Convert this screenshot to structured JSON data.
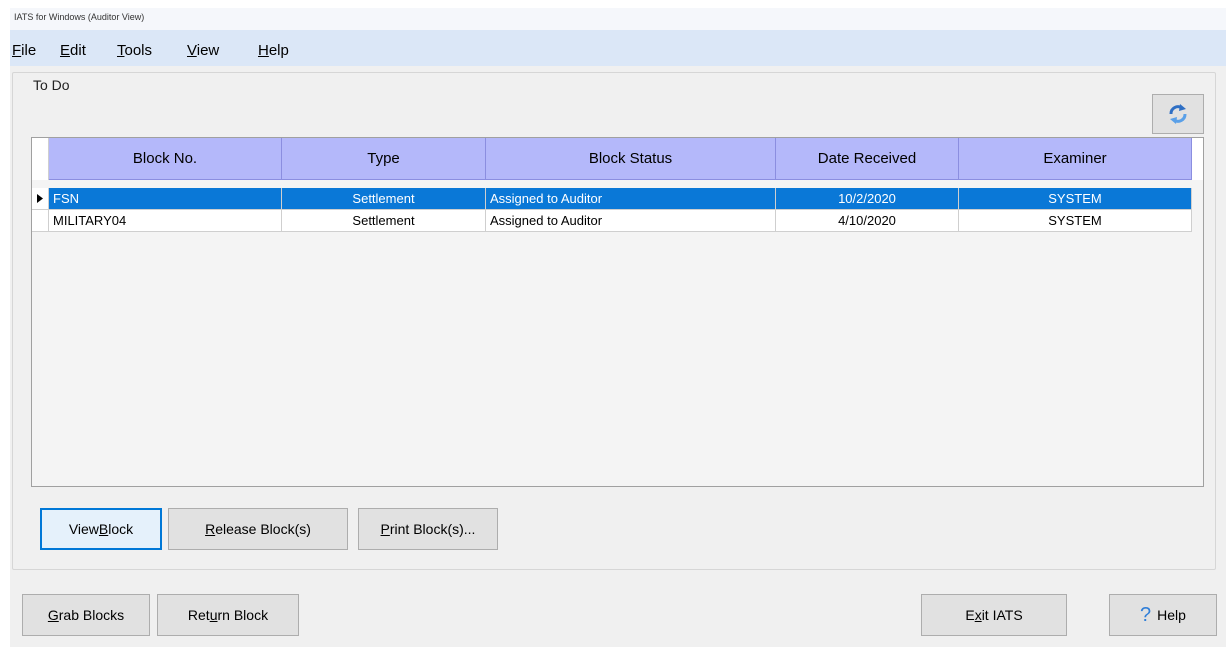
{
  "window": {
    "title": "IATS for Windows (Auditor View)"
  },
  "menu": [
    {
      "label": "File",
      "mnemonic": "F",
      "rest": "ile"
    },
    {
      "label": "Edit",
      "mnemonic": "E",
      "rest": "dit"
    },
    {
      "label": "Tools",
      "mnemonic": "T",
      "rest": "ools"
    },
    {
      "label": "View",
      "mnemonic": "V",
      "rest": "iew"
    },
    {
      "label": "Help",
      "mnemonic": "H",
      "rest": "elp"
    }
  ],
  "todo": {
    "group_label": "To Do",
    "refresh_icon": "refresh-icon",
    "columns": [
      "Block No.",
      "Type",
      "Block Status",
      "Date Received",
      "Examiner"
    ],
    "rows": [
      {
        "block_no": "FSN",
        "type": "Settlement",
        "status": "Assigned to Auditor",
        "date": "10/2/2020",
        "examiner": "SYSTEM",
        "selected": true
      },
      {
        "block_no": "MILITARY04",
        "type": "Settlement",
        "status": "Assigned to Auditor",
        "date": "4/10/2020",
        "examiner": "SYSTEM",
        "selected": false
      }
    ]
  },
  "buttons": {
    "view_block": {
      "pre": "View ",
      "mnemonic": "B",
      "post": "lock"
    },
    "release_block": {
      "pre": "",
      "mnemonic": "R",
      "post": "elease Block(s)"
    },
    "print_block": {
      "pre": "",
      "mnemonic": "P",
      "post": "rint Block(s)..."
    },
    "grab_blocks": {
      "pre": "",
      "mnemonic": "G",
      "post": "rab Blocks"
    },
    "return_block": {
      "pre": "Ret",
      "mnemonic": "u",
      "post": "rn Block"
    },
    "exit_iats": {
      "pre": "E",
      "mnemonic": "x",
      "post": "it IATS"
    },
    "help": {
      "label": "Help",
      "icon": "question-mark-icon"
    }
  },
  "colors": {
    "menubar": "#dbe7f7",
    "grid_header": "#b4b8fa",
    "selection": "#0a78d7",
    "help_icon": "#2f7ed8"
  }
}
